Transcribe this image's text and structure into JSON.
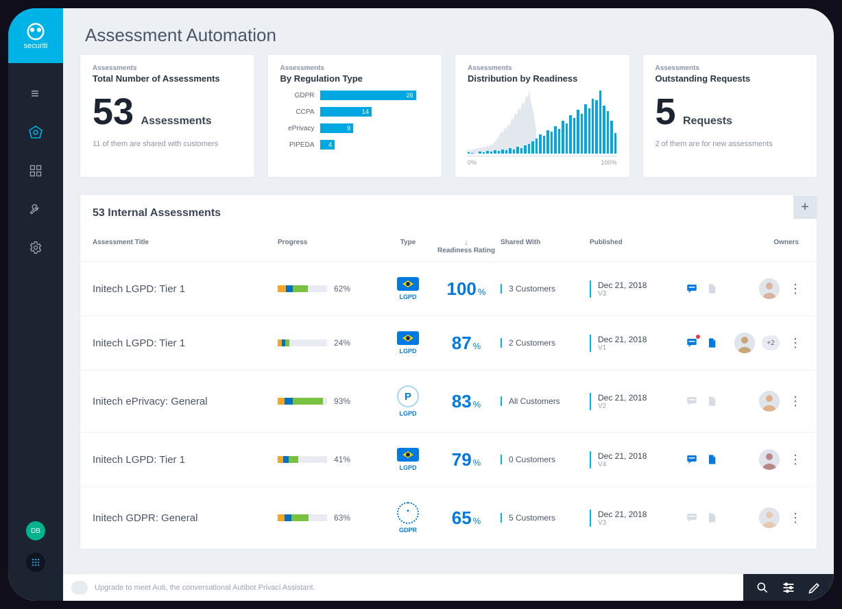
{
  "brand": "securiti",
  "page_title": "Assessment Automation",
  "sidebar_avatar": "DB",
  "cards": {
    "kicker": "Assessments",
    "total": {
      "title": "Total Number of Assessments",
      "value": "53",
      "label": "Assessments",
      "note": "11 of them are shared with customers"
    },
    "by_reg": {
      "title": "By Regulation Type"
    },
    "distribution": {
      "title": "Distribution by Readiness",
      "axis_min": "0%",
      "axis_max": "100%"
    },
    "outstanding": {
      "title": "Outstanding Requests",
      "value": "5",
      "label": "Requests",
      "note": "2 of them are for new assessments"
    }
  },
  "chart_data": {
    "by_regulation": {
      "type": "bar",
      "orientation": "horizontal",
      "categories": [
        "GDPR",
        "CCPA",
        "ePrivacy",
        "PIPEDA"
      ],
      "values": [
        26,
        14,
        9,
        4
      ],
      "max": 26
    },
    "readiness_distribution": {
      "type": "histogram",
      "xlabel_min": "0%",
      "xlabel_max": "100%",
      "values": [
        2,
        1,
        0,
        3,
        2,
        4,
        3,
        5,
        4,
        6,
        5,
        8,
        6,
        10,
        8,
        12,
        14,
        18,
        22,
        28,
        26,
        34,
        32,
        40,
        36,
        48,
        44,
        56,
        52,
        64,
        58,
        72,
        66,
        80,
        78,
        92,
        70,
        62,
        48,
        30
      ]
    }
  },
  "table": {
    "title": "53 Internal Assessments",
    "columns": {
      "title": "Assessment Title",
      "progress": "Progress",
      "type": "Type",
      "readiness": "Readiness Rating",
      "shared": "Shared With",
      "published": "Published",
      "owners": "Owners"
    },
    "rows": [
      {
        "title": "Initech LGPD: Tier 1",
        "progress": "62%",
        "progress_segments": [
          [
            "#f5a623",
            12
          ],
          [
            "#0072c6",
            10
          ],
          [
            "#7ac142",
            22
          ]
        ],
        "type_label": "LGPD",
        "type_icon": "flag-br",
        "readiness": "100",
        "shared": "3 Customers",
        "published": "Dec 21, 2018",
        "version": "V3",
        "chat_state": "active",
        "doc_state": "muted",
        "owners_extra": ""
      },
      {
        "title": "Initech LGPD: Tier 1",
        "progress": "24%",
        "progress_segments": [
          [
            "#f5a623",
            6
          ],
          [
            "#0072c6",
            5
          ],
          [
            "#7ac142",
            6
          ]
        ],
        "type_label": "LGPD",
        "type_icon": "flag-br",
        "readiness": "87",
        "shared": "2 Customers",
        "published": "Dec 21, 2018",
        "version": "V1",
        "chat_state": "alert",
        "doc_state": "active",
        "owners_extra": "+2"
      },
      {
        "title": "Initech ePrivacy: General",
        "progress": "93%",
        "progress_segments": [
          [
            "#f5a623",
            10
          ],
          [
            "#0072c6",
            12
          ],
          [
            "#7ac142",
            44
          ]
        ],
        "type_label": "LGPD",
        "type_icon": "p-circle",
        "readiness": "83",
        "shared": "All Customers",
        "published": "Dec 21, 2018",
        "version": "V2",
        "chat_state": "muted",
        "doc_state": "muted",
        "owners_extra": ""
      },
      {
        "title": "Initech LGPD: Tier 1",
        "progress": "41%",
        "progress_segments": [
          [
            "#f5a623",
            8
          ],
          [
            "#0072c6",
            8
          ],
          [
            "#7ac142",
            14
          ]
        ],
        "type_label": "LGPD",
        "type_icon": "flag-br",
        "readiness": "79",
        "shared": "0 Customers",
        "published": "Dec 21, 2018",
        "version": "V4",
        "chat_state": "active",
        "doc_state": "active",
        "owners_extra": ""
      },
      {
        "title": "Initech GDPR: General",
        "progress": "63%",
        "progress_segments": [
          [
            "#f5a623",
            10
          ],
          [
            "#0072c6",
            10
          ],
          [
            "#7ac142",
            25
          ]
        ],
        "type_label": "GDPR",
        "type_icon": "stars-circle",
        "readiness": "65",
        "shared": "5 Customers",
        "published": "Dec 21, 2018",
        "version": "V3",
        "chat_state": "muted",
        "doc_state": "muted",
        "owners_extra": ""
      }
    ]
  },
  "bottom_bar": {
    "text": "Upgrade to meet Auti, the conversational Autibot Privaci Assistant."
  }
}
